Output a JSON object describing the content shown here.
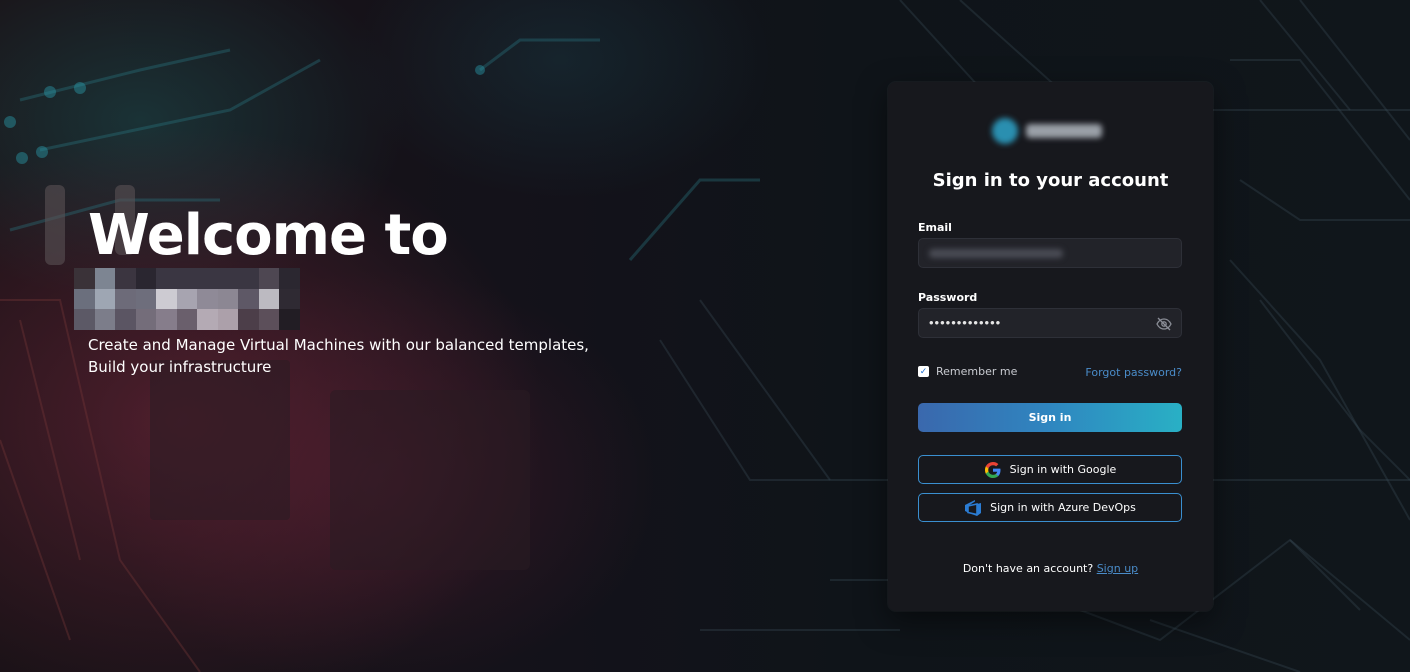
{
  "hero": {
    "welcome": "Welcome to",
    "subtitle_line1": "Create and Manage Virtual Machines with our balanced templates,",
    "subtitle_line2": "Build your infrastructure"
  },
  "login": {
    "title": "Sign in to your account",
    "email_label": "Email",
    "password_label": "Password",
    "password_value": "•••••••••••••",
    "remember_label": "Remember me",
    "remember_checked": true,
    "forgot_link": "Forgot password?",
    "signin_button": "Sign in",
    "google_button": "Sign in with Google",
    "azure_button": "Sign in with Azure DevOps",
    "signup_prompt": "Don't have an account?",
    "signup_link": "Sign up"
  },
  "colors": {
    "accent_link": "#4a8cc9",
    "primary_gradient_start": "#3a68ad",
    "primary_gradient_end": "#29b0c5",
    "card_background": "#17181d",
    "outline_border": "#3a8fd0"
  },
  "icons": [
    "checkbox-check-icon",
    "eye-off-icon",
    "google-icon",
    "azure-devops-icon"
  ]
}
